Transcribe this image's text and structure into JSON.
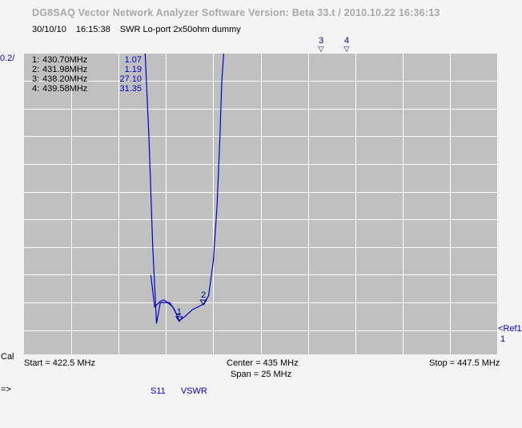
{
  "header": {
    "title": "DG8SAQ Vector Network Analyzer Software   Version:  Beta 33.t / 2010.10.22 16:36:13",
    "date": "30/10/10",
    "time": "16:15:38",
    "description": "SWR Lo-port  2x50ohm dummy"
  },
  "left_labels": {
    "scale": "0.2/",
    "cal": "Cal",
    "arrow": "=>"
  },
  "right_labels": {
    "ref": "<Ref1",
    "ref_value": "1"
  },
  "markers": [
    {
      "id": "1:",
      "freq": "430.70MHz",
      "value": "1.07"
    },
    {
      "id": "2:",
      "freq": "431.98MHz",
      "value": "1.19"
    },
    {
      "id": "3:",
      "freq": "438.20MHz",
      "value": "27.10"
    },
    {
      "id": "4:",
      "freq": "439.58MHz",
      "value": "31.35"
    }
  ],
  "top_markers": [
    {
      "label": "3",
      "symbol": "▽"
    },
    {
      "label": "4",
      "symbol": "▽"
    }
  ],
  "axis": {
    "start": "Start = 422.5 MHz",
    "center": "Center = 435 MHz",
    "span": "Span = 25 MHz",
    "stop": "Stop = 447.5 MHz"
  },
  "trace_legend": {
    "param": "S11",
    "format": "VSWR"
  },
  "chart_data": {
    "type": "line",
    "x_unit": "MHz",
    "xlim": [
      422.5,
      447.5
    ],
    "ylim": [
      1.0,
      3.0
    ],
    "y_per_div": 0.2,
    "reference": 1,
    "grid": true,
    "series": [
      {
        "color": "#0000cc",
        "x": [
          428.9,
          429.1,
          429.3,
          429.5,
          429.7,
          429.9,
          430.2,
          430.45,
          430.7,
          431.0,
          431.4,
          431.98,
          432.25,
          432.5,
          432.7,
          432.85,
          432.95,
          433.05
        ],
        "y": [
          3.0,
          2.4,
          1.6,
          1.05,
          1.2,
          1.2,
          1.2,
          1.15,
          1.07,
          1.1,
          1.15,
          1.19,
          1.25,
          1.5,
          1.9,
          2.4,
          2.8,
          3.0
        ]
      },
      {
        "color": "#0000cc",
        "x": [
          429.2,
          429.4,
          429.55,
          429.7,
          429.9,
          430.1,
          430.35,
          430.55,
          430.75
        ],
        "y": [
          1.4,
          1.17,
          1.19,
          1.21,
          1.22,
          1.2,
          1.17,
          1.12,
          1.11
        ]
      }
    ],
    "markers": [
      {
        "id": 1,
        "x": 430.7,
        "y": 1.07
      },
      {
        "id": 2,
        "x": 431.98,
        "y": 1.19
      }
    ]
  }
}
